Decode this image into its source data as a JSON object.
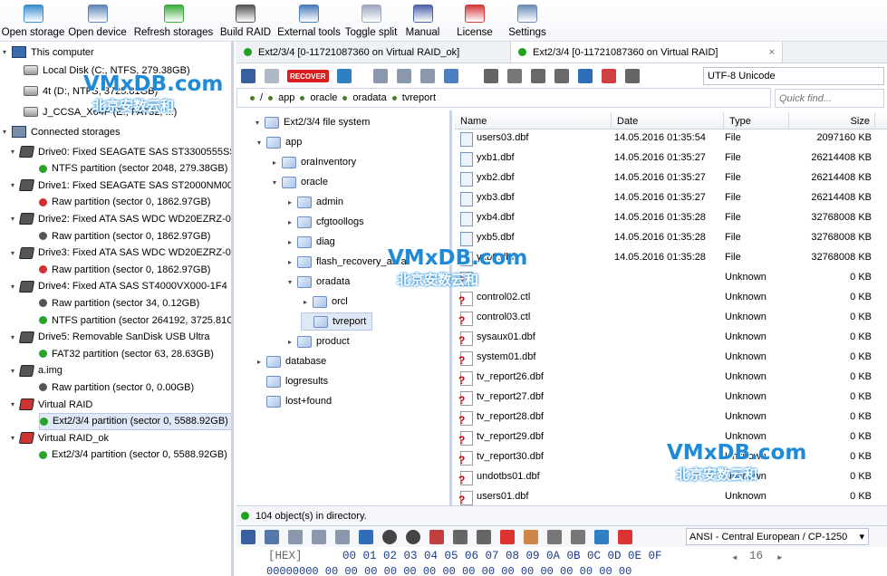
{
  "toolbar": {
    "items": [
      {
        "label": "Open storage",
        "icon": "open-storage-icon",
        "color": "#3a8fd0"
      },
      {
        "label": "Open device",
        "icon": "open-device-icon",
        "color": "#5b86b8"
      },
      {
        "label": "Refresh storages",
        "icon": "refresh-icon",
        "color": "#3cac3c"
      },
      {
        "label": "Build RAID",
        "icon": "raid-icon",
        "color": "#555555"
      },
      {
        "label": "External tools",
        "icon": "tools-icon",
        "color": "#4a7cb8"
      },
      {
        "label": "Toggle split",
        "icon": "split-icon",
        "color": "#9aa8c0"
      },
      {
        "label": "Manual",
        "icon": "book-icon",
        "color": "#4b63a8"
      },
      {
        "label": "License",
        "icon": "license-icon",
        "color": "#d23a3a"
      },
      {
        "label": "Settings",
        "icon": "gear-icon",
        "color": "#6a8cb8"
      }
    ]
  },
  "left": {
    "this_computer": "This computer",
    "local_disks": [
      "Local Disk (C:, NTFS, 279.38GB)",
      "4t (D:, NTFS, 3725.81GB)",
      "J_CCSA_X64F (E:, FAT32, ...)"
    ],
    "connected": "Connected storages",
    "tree": [
      {
        "label": "Drive0: Fixed SEAGATE SAS ST3300555SS",
        "kind": "drive"
      },
      {
        "label": "NTFS partition (sector 2048, 279.38GB)",
        "kind": "part",
        "status": "#2aa32a"
      },
      {
        "label": "Drive1: Fixed SEAGATE SAS ST2000NM002",
        "kind": "drive"
      },
      {
        "label": "Raw partition (sector 0, 1862.97GB)",
        "kind": "part",
        "status": "#d32f2f"
      },
      {
        "label": "Drive2: Fixed ATA SAS WDC WD20EZRZ-0",
        "kind": "drive"
      },
      {
        "label": "Raw partition (sector 0, 1862.97GB)",
        "kind": "part",
        "status": "#555555"
      },
      {
        "label": "Drive3: Fixed ATA SAS WDC WD20EZRZ-0",
        "kind": "drive"
      },
      {
        "label": "Raw partition (sector 0, 1862.97GB)",
        "kind": "part",
        "status": "#d32f2f"
      },
      {
        "label": "Drive4: Fixed ATA SAS ST4000VX000-1F4",
        "kind": "drive"
      },
      {
        "label": "Raw partition (sector 34, 0.12GB)",
        "kind": "part",
        "status": "#555555"
      },
      {
        "label": "NTFS partition (sector 264192, 3725.81G",
        "kind": "part",
        "status": "#2aa32a"
      },
      {
        "label": "Drive5: Removable SanDisk USB Ultra",
        "kind": "drive"
      },
      {
        "label": "FAT32 partition (sector 63, 28.63GB)",
        "kind": "part",
        "status": "#2aa32a"
      },
      {
        "label": "a.img",
        "kind": "drive"
      },
      {
        "label": "Raw partition (sector 0, 0.00GB)",
        "kind": "part",
        "status": "#555555"
      },
      {
        "label": "Virtual RAID",
        "kind": "raid"
      },
      {
        "label": "Ext2/3/4 partition (sector 0, 5588.92GB)",
        "kind": "part",
        "status": "#2aa32a"
      },
      {
        "label": "Virtual RAID_ok",
        "kind": "raid"
      },
      {
        "label": "Ext2/3/4 partition (sector 0, 5588.92GB)",
        "kind": "part",
        "status": "#2aa32a"
      }
    ]
  },
  "tabs": [
    {
      "label": "Ext2/3/4 [0-11721087360 on Virtual RAID_ok]"
    },
    {
      "label": "Ext2/3/4 [0-11721087360 on Virtual RAID]",
      "close": "×"
    }
  ],
  "subtoolbar": {
    "recover": "RECOVER",
    "encoding": "UTF-8 Unicode"
  },
  "path": {
    "segments": [
      "/",
      "app",
      "oracle",
      "oradata",
      "tvreport"
    ]
  },
  "quickfind": {
    "placeholder": "Quick find..."
  },
  "folders": [
    {
      "label": "Ext2/3/4 file system",
      "depth": 0,
      "tri": "▾"
    },
    {
      "label": "app",
      "depth": 1,
      "tri": "▾"
    },
    {
      "label": "oraInventory",
      "depth": 2,
      "tri": "▸"
    },
    {
      "label": "oracle",
      "depth": 2,
      "tri": "▾"
    },
    {
      "label": "admin",
      "depth": 3,
      "tri": "▸"
    },
    {
      "label": "cfgtoollogs",
      "depth": 3,
      "tri": "▸"
    },
    {
      "label": "diag",
      "depth": 3,
      "tri": "▸"
    },
    {
      "label": "flash_recovery_area",
      "depth": 3,
      "tri": "▸"
    },
    {
      "label": "oradata",
      "depth": 3,
      "tri": "▾"
    },
    {
      "label": "orcl",
      "depth": 4,
      "tri": "▸"
    },
    {
      "label": "tvreport",
      "depth": 4,
      "tri": ""
    },
    {
      "label": "product",
      "depth": 3,
      "tri": "▸"
    },
    {
      "label": "database",
      "depth": 1,
      "tri": "▸"
    },
    {
      "label": "logresults",
      "depth": 1,
      "tri": ""
    },
    {
      "label": "lost+found",
      "depth": 1,
      "tri": ""
    }
  ],
  "files": {
    "headers": {
      "name": "Name",
      "date": "Date",
      "type": "Type",
      "size": "Size"
    },
    "rows": [
      {
        "name": "users03.dbf",
        "date": "14.05.2016 01:35:54",
        "type": "File",
        "size": "2097160 KB",
        "ok": true
      },
      {
        "name": "yxb1.dbf",
        "date": "14.05.2016 01:35:27",
        "type": "File",
        "size": "26214408 KB",
        "ok": true
      },
      {
        "name": "yxb2.dbf",
        "date": "14.05.2016 01:35:27",
        "type": "File",
        "size": "26214408 KB",
        "ok": true
      },
      {
        "name": "yxb3.dbf",
        "date": "14.05.2016 01:35:27",
        "type": "File",
        "size": "26214408 KB",
        "ok": true
      },
      {
        "name": "yxb4.dbf",
        "date": "14.05.2016 01:35:28",
        "type": "File",
        "size": "32768008 KB",
        "ok": true
      },
      {
        "name": "yxb5.dbf",
        "date": "14.05.2016 01:35:28",
        "type": "File",
        "size": "32768008 KB",
        "ok": true
      },
      {
        "name": "yxb6.dbf",
        "date": "14.05.2016 01:35:28",
        "type": "File",
        "size": "32768008 KB",
        "ok": true
      },
      {
        "name": "",
        "date": "",
        "type": "Unknown",
        "size": "0 KB",
        "ok": false
      },
      {
        "name": "control02.ctl",
        "date": "",
        "type": "Unknown",
        "size": "0 KB",
        "ok": false
      },
      {
        "name": "control03.ctl",
        "date": "",
        "type": "Unknown",
        "size": "0 KB",
        "ok": false
      },
      {
        "name": "sysaux01.dbf",
        "date": "",
        "type": "Unknown",
        "size": "0 KB",
        "ok": false
      },
      {
        "name": "system01.dbf",
        "date": "",
        "type": "Unknown",
        "size": "0 KB",
        "ok": false
      },
      {
        "name": "tv_report26.dbf",
        "date": "",
        "type": "Unknown",
        "size": "0 KB",
        "ok": false
      },
      {
        "name": "tv_report27.dbf",
        "date": "",
        "type": "Unknown",
        "size": "0 KB",
        "ok": false
      },
      {
        "name": "tv_report28.dbf",
        "date": "",
        "type": "Unknown",
        "size": "0 KB",
        "ok": false
      },
      {
        "name": "tv_report29.dbf",
        "date": "",
        "type": "Unknown",
        "size": "0 KB",
        "ok": false
      },
      {
        "name": "tv_report30.dbf",
        "date": "",
        "type": "Unknown",
        "size": "0 KB",
        "ok": false
      },
      {
        "name": "undotbs01.dbf",
        "date": "",
        "type": "Unknown",
        "size": "0 KB",
        "ok": false
      },
      {
        "name": "users01.dbf",
        "date": "",
        "type": "Unknown",
        "size": "0 KB",
        "ok": false
      }
    ]
  },
  "status": {
    "text": "104 object(s) in directory."
  },
  "hex": {
    "codepage": "ANSI - Central European / CP-1250",
    "page": "16",
    "hdr": "[HEX]",
    "cols": "00 01 02 03 04 05 06 07 08 09 0A 0B 0C 0D 0E 0F",
    "row": "00000000  00 00 00 00 00 00 00 00 00 00 00 00 00 00 00 00"
  },
  "watermarks": [
    {
      "a": "VMxDB.com",
      "b": "北京安数云和"
    },
    {
      "a": "VMxDB.com",
      "b": "北京安数云和"
    },
    {
      "a": "VMxDB.com",
      "b": "北京安数云和"
    }
  ]
}
